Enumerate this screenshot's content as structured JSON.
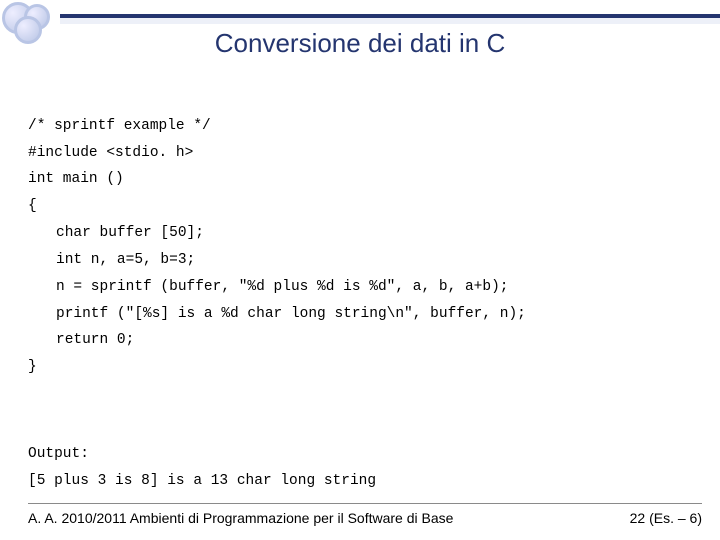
{
  "title": "Conversione dei dati in C",
  "code": {
    "l1": "/* sprintf example */",
    "l2": "#include <stdio. h>",
    "l3": "int main ()",
    "l4": "{",
    "l5": "char buffer [50];",
    "l6": "int n, a=5, b=3;",
    "l7": "n = sprintf (buffer, \"%d plus %d is %d\", a, b, a+b);",
    "l8": "printf (\"[%s] is a %d char long string\\n\", buffer, n);",
    "l9": "return 0;",
    "l10": "}"
  },
  "output": {
    "label": "Output:",
    "line": "[5 plus 3 is 8] is a 13 char long string"
  },
  "footer": {
    "left": "A. A. 2010/2011 Ambienti di Programmazione per il Software di Base",
    "right": "22 (Es. – 6)"
  }
}
